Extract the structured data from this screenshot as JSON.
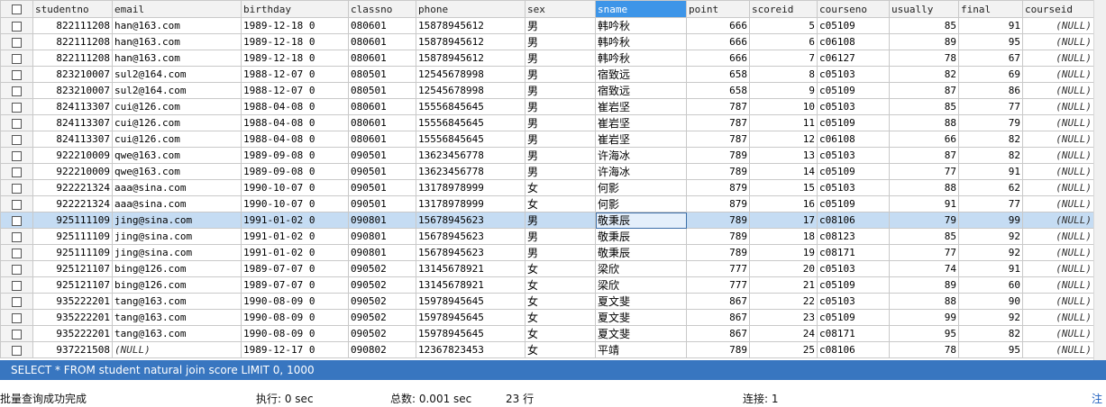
{
  "columns": [
    "studentno",
    "email",
    "birthday",
    "classno",
    "phone",
    "sex",
    "sname",
    "point",
    "scoreid",
    "courseno",
    "usually",
    "final",
    "courseid"
  ],
  "selected_column": "sname",
  "selected_row_index": 12,
  "null_label": "(NULL)",
  "rows": [
    [
      "822111208",
      "han@163.com",
      "1989-12-18 0",
      "080601",
      "15878945612",
      "男",
      "韩吟秋",
      "666",
      "5",
      "c05109",
      "85",
      "91",
      "(NULL)"
    ],
    [
      "822111208",
      "han@163.com",
      "1989-12-18 0",
      "080601",
      "15878945612",
      "男",
      "韩吟秋",
      "666",
      "6",
      "c06108",
      "89",
      "95",
      "(NULL)"
    ],
    [
      "822111208",
      "han@163.com",
      "1989-12-18 0",
      "080601",
      "15878945612",
      "男",
      "韩吟秋",
      "666",
      "7",
      "c06127",
      "78",
      "67",
      "(NULL)"
    ],
    [
      "823210007",
      "sul2@164.com",
      "1988-12-07 0",
      "080501",
      "12545678998",
      "男",
      "宿致远",
      "658",
      "8",
      "c05103",
      "82",
      "69",
      "(NULL)"
    ],
    [
      "823210007",
      "sul2@164.com",
      "1988-12-07 0",
      "080501",
      "12545678998",
      "男",
      "宿致远",
      "658",
      "9",
      "c05109",
      "87",
      "86",
      "(NULL)"
    ],
    [
      "824113307",
      "cui@126.com",
      "1988-04-08 0",
      "080601",
      "15556845645",
      "男",
      "崔岩坚",
      "787",
      "10",
      "c05103",
      "85",
      "77",
      "(NULL)"
    ],
    [
      "824113307",
      "cui@126.com",
      "1988-04-08 0",
      "080601",
      "15556845645",
      "男",
      "崔岩坚",
      "787",
      "11",
      "c05109",
      "88",
      "79",
      "(NULL)"
    ],
    [
      "824113307",
      "cui@126.com",
      "1988-04-08 0",
      "080601",
      "15556845645",
      "男",
      "崔岩坚",
      "787",
      "12",
      "c06108",
      "66",
      "82",
      "(NULL)"
    ],
    [
      "922210009",
      "qwe@163.com",
      "1989-09-08 0",
      "090501",
      "13623456778",
      "男",
      "许海冰",
      "789",
      "13",
      "c05103",
      "87",
      "82",
      "(NULL)"
    ],
    [
      "922210009",
      "qwe@163.com",
      "1989-09-08 0",
      "090501",
      "13623456778",
      "男",
      "许海冰",
      "789",
      "14",
      "c05109",
      "77",
      "91",
      "(NULL)"
    ],
    [
      "922221324",
      "aaa@sina.com",
      "1990-10-07 0",
      "090501",
      "13178978999",
      "女",
      "何影",
      "879",
      "15",
      "c05103",
      "88",
      "62",
      "(NULL)"
    ],
    [
      "922221324",
      "aaa@sina.com",
      "1990-10-07 0",
      "090501",
      "13178978999",
      "女",
      "何影",
      "879",
      "16",
      "c05109",
      "91",
      "77",
      "(NULL)"
    ],
    [
      "925111109",
      "jing@sina.com",
      "1991-01-02 0",
      "090801",
      "15678945623",
      "男",
      "敬秉辰",
      "789",
      "17",
      "c08106",
      "79",
      "99",
      "(NULL)"
    ],
    [
      "925111109",
      "jing@sina.com",
      "1991-01-02 0",
      "090801",
      "15678945623",
      "男",
      "敬秉辰",
      "789",
      "18",
      "c08123",
      "85",
      "92",
      "(NULL)"
    ],
    [
      "925111109",
      "jing@sina.com",
      "1991-01-02 0",
      "090801",
      "15678945623",
      "男",
      "敬秉辰",
      "789",
      "19",
      "c08171",
      "77",
      "92",
      "(NULL)"
    ],
    [
      "925121107",
      "bing@126.com",
      "1989-07-07 0",
      "090502",
      "13145678921",
      "女",
      "梁欣",
      "777",
      "20",
      "c05103",
      "74",
      "91",
      "(NULL)"
    ],
    [
      "925121107",
      "bing@126.com",
      "1989-07-07 0",
      "090502",
      "13145678921",
      "女",
      "梁欣",
      "777",
      "21",
      "c05109",
      "89",
      "60",
      "(NULL)"
    ],
    [
      "935222201",
      "tang@163.com",
      "1990-08-09 0",
      "090502",
      "15978945645",
      "女",
      "夏文斐",
      "867",
      "22",
      "c05103",
      "88",
      "90",
      "(NULL)"
    ],
    [
      "935222201",
      "tang@163.com",
      "1990-08-09 0",
      "090502",
      "15978945645",
      "女",
      "夏文斐",
      "867",
      "23",
      "c05109",
      "99",
      "92",
      "(NULL)"
    ],
    [
      "935222201",
      "tang@163.com",
      "1990-08-09 0",
      "090502",
      "15978945645",
      "女",
      "夏文斐",
      "867",
      "24",
      "c08171",
      "95",
      "82",
      "(NULL)"
    ],
    [
      "937221508",
      "(NULL)",
      "1989-12-17 0",
      "090802",
      "12367823453",
      "女",
      "平靖",
      "789",
      "25",
      "c08106",
      "78",
      "95",
      "(NULL)"
    ]
  ],
  "query": "SELECT * FROM student natural join score LIMIT 0, 1000",
  "status": {
    "message": "批量查询成功完成",
    "exec": "执行: 0 sec",
    "total": "总数: 0.001 sec",
    "rows": "23 行",
    "connection": "连接: 1",
    "more": "注"
  }
}
